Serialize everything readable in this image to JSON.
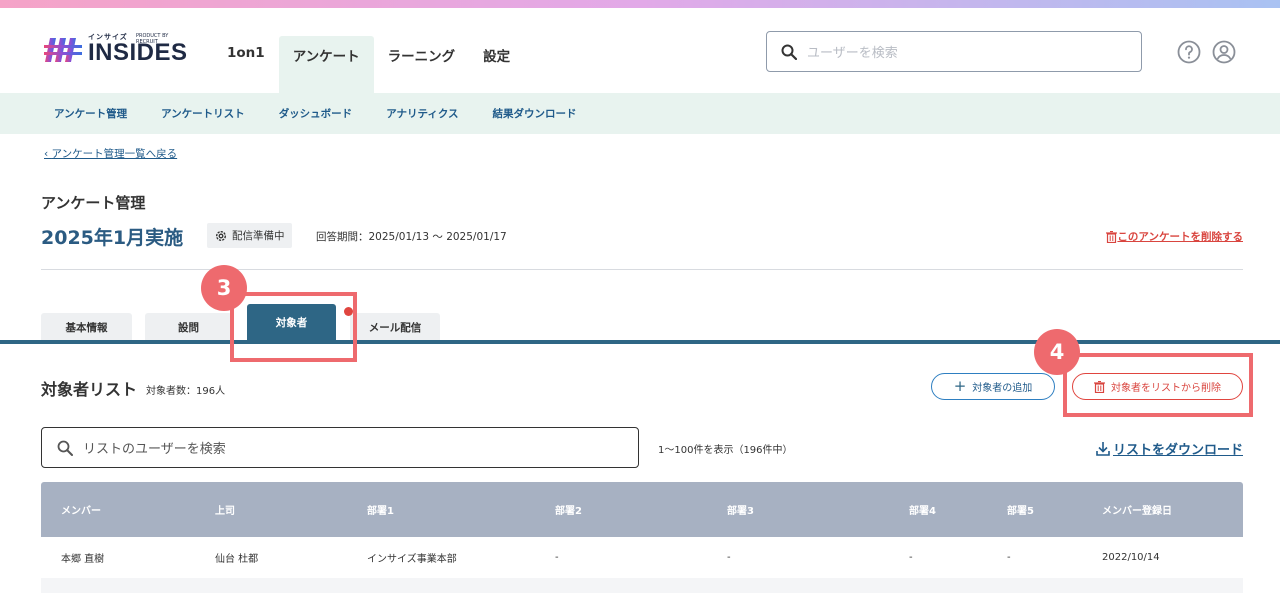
{
  "logo": {
    "small_text": "インサイズ",
    "sub_text": "PRODUCT BY RECRUIT",
    "main_text": "INSIDES"
  },
  "global_nav": [
    {
      "label": "1on1"
    },
    {
      "label": "アンケート"
    },
    {
      "label": "ラーニング"
    },
    {
      "label": "設定"
    }
  ],
  "header_search": {
    "placeholder": "ユーザーを検索"
  },
  "sub_nav": [
    {
      "label": "アンケート管理"
    },
    {
      "label": "アンケートリスト"
    },
    {
      "label": "ダッシュボード"
    },
    {
      "label": "アナリティクス"
    },
    {
      "label": "結果ダウンロード"
    }
  ],
  "breadcrumb": "アンケート管理一覧へ戻る",
  "page": {
    "label": "アンケート管理",
    "title": "2025年1月実施",
    "status": "配信準備中",
    "period": "回答期間：2025/01/13 〜 2025/01/17",
    "delete_link": "このアンケートを削除する"
  },
  "tabs": [
    {
      "label": "基本情報"
    },
    {
      "label": "設問"
    },
    {
      "label": "対象者"
    },
    {
      "label": "メール配信"
    }
  ],
  "annotations": {
    "step3": "3",
    "step4": "4"
  },
  "target_list": {
    "title": "対象者リスト",
    "count": "対象者数：196人",
    "add_label": "対象者の追加",
    "remove_label": "対象者をリストから削除",
    "search_placeholder": "リストのユーザーを検索",
    "range": "1〜100件を表示（196件中）",
    "download_label": "リストをダウンロード"
  },
  "table": {
    "headers": [
      "メンバー",
      "上司",
      "部署1",
      "部署2",
      "部署3",
      "部署4",
      "部署5",
      "メンバー登録日"
    ],
    "rows": [
      [
        "本郷 直樹",
        "仙台 杜都",
        "インサイズ事業本部",
        "-",
        "-",
        "-",
        "-",
        "2022/10/14"
      ]
    ]
  },
  "colors": {
    "accent": "#2e6685",
    "danger": "#d9453f",
    "annotation": "#ee6a6e",
    "subnav_bg": "#e8f3ef"
  }
}
